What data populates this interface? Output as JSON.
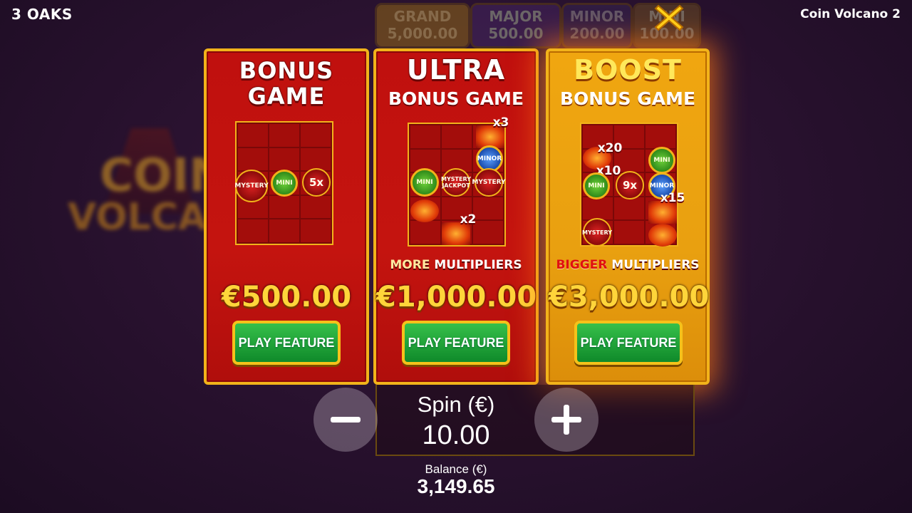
{
  "header": {
    "brand": "3 OAKS",
    "game_title": "Coin Volcano 2"
  },
  "background_logo": {
    "line1": "COIN",
    "line2": "VOLCANO"
  },
  "jackpots": [
    {
      "name": "GRAND",
      "value": "5,000.00"
    },
    {
      "name": "MAJOR",
      "value": "500.00"
    },
    {
      "name": "MINOR",
      "value": "200.00"
    },
    {
      "name": "MINI",
      "value": "100.00"
    }
  ],
  "panels": [
    {
      "title": "BONUS",
      "subtitle": "GAME",
      "price": "€500.00",
      "button": "PLAY FEATURE",
      "symbols": {
        "mystery": "MYSTERY",
        "mini": "MINI",
        "mult": "5x"
      }
    },
    {
      "title": "ULTRA",
      "subtitle": "BONUS GAME",
      "highlight": "MORE",
      "multipliers": "MULTIPLIERS",
      "price": "€1,000.00",
      "button": "PLAY FEATURE",
      "symbols": {
        "x3": "x3",
        "minor": "MINOR",
        "mini": "MINI",
        "mystery_jackpot": "MYSTERY JACKPOT",
        "mystery": "MYSTERY",
        "x2": "x2"
      }
    },
    {
      "title": "BOOST",
      "subtitle": "BONUS GAME",
      "highlight": "BIGGER",
      "multipliers": "MULTIPLIERS",
      "price": "€3,000.00",
      "button": "PLAY FEATURE",
      "symbols": {
        "x20": "x20",
        "x10": "x10",
        "mini1": "MINI",
        "mini2": "MINI",
        "mult": "9x",
        "minor": "MINOR",
        "x15": "x15",
        "mystery": "MYSTERY"
      }
    }
  ],
  "spin": {
    "label": "Spin (€)",
    "value": "10.00"
  },
  "balance": {
    "label": "Balance (€)",
    "value": "3,149.65"
  },
  "colors": {
    "panel_red": "#c0100e",
    "panel_gold": "#f0a610",
    "button_green": "#1ea83a",
    "price_gold": "#ffd53a"
  }
}
